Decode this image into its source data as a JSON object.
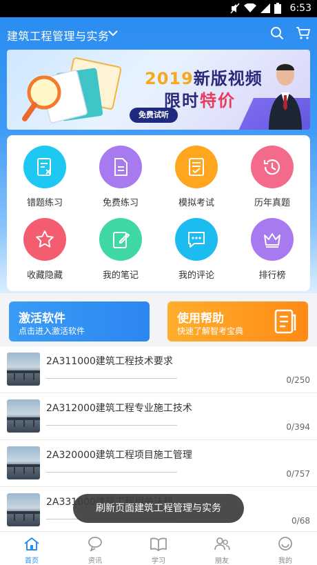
{
  "status_bar": {
    "time": "6:53"
  },
  "app_bar": {
    "title": "建筑工程管理与实务"
  },
  "banner": {
    "headline_year": "2019",
    "headline_rest": "新版视频",
    "line2_a": "限时",
    "line2_hl": "特价",
    "free_label": "免费试听"
  },
  "grid": [
    {
      "label": "错题练习",
      "color": "#1ec8f2",
      "icon": "wrong-question-icon"
    },
    {
      "label": "免费练习",
      "color": "#a77af0",
      "icon": "document-icon"
    },
    {
      "label": "模拟考试",
      "color": "#ffa51e",
      "icon": "checklist-icon"
    },
    {
      "label": "历年真题",
      "color": "#f46a8b",
      "icon": "history-clock-icon"
    },
    {
      "label": "收藏隐藏",
      "color": "#f45c6f",
      "icon": "star-icon"
    },
    {
      "label": "我的笔记",
      "color": "#3fd7a6",
      "icon": "note-edit-icon"
    },
    {
      "label": "我的评论",
      "color": "#1dbcf0",
      "icon": "comment-icon"
    },
    {
      "label": "排行榜",
      "color": "#a77af0",
      "icon": "crown-icon"
    }
  ],
  "actions": {
    "activate": {
      "title": "激活软件",
      "subtitle": "点击进入激活软件"
    },
    "help": {
      "title": "使用帮助",
      "subtitle": "快速了解智考宝典"
    }
  },
  "chapters": [
    {
      "title": "2A311000建筑工程技术要求",
      "count": "0/250"
    },
    {
      "title": "2A312000建筑工程专业施工技术",
      "count": "0/394"
    },
    {
      "title": "2A320000建筑工程项目施工管理",
      "count": "0/757"
    },
    {
      "title": "2A331000建筑工程相关法规",
      "count": "0/68"
    }
  ],
  "toast": "刷新页面建筑工程管理与实务",
  "tabs": [
    {
      "label": "首页",
      "icon": "home-icon",
      "active": true
    },
    {
      "label": "资讯",
      "icon": "news-icon"
    },
    {
      "label": "学习",
      "icon": "book-icon"
    },
    {
      "label": "朋友",
      "icon": "friends-icon"
    },
    {
      "label": "我的",
      "icon": "profile-icon"
    }
  ],
  "colors": {
    "primary": "#2b8df0",
    "activate": "#3a9cf6",
    "help": "#ff9a1e"
  }
}
